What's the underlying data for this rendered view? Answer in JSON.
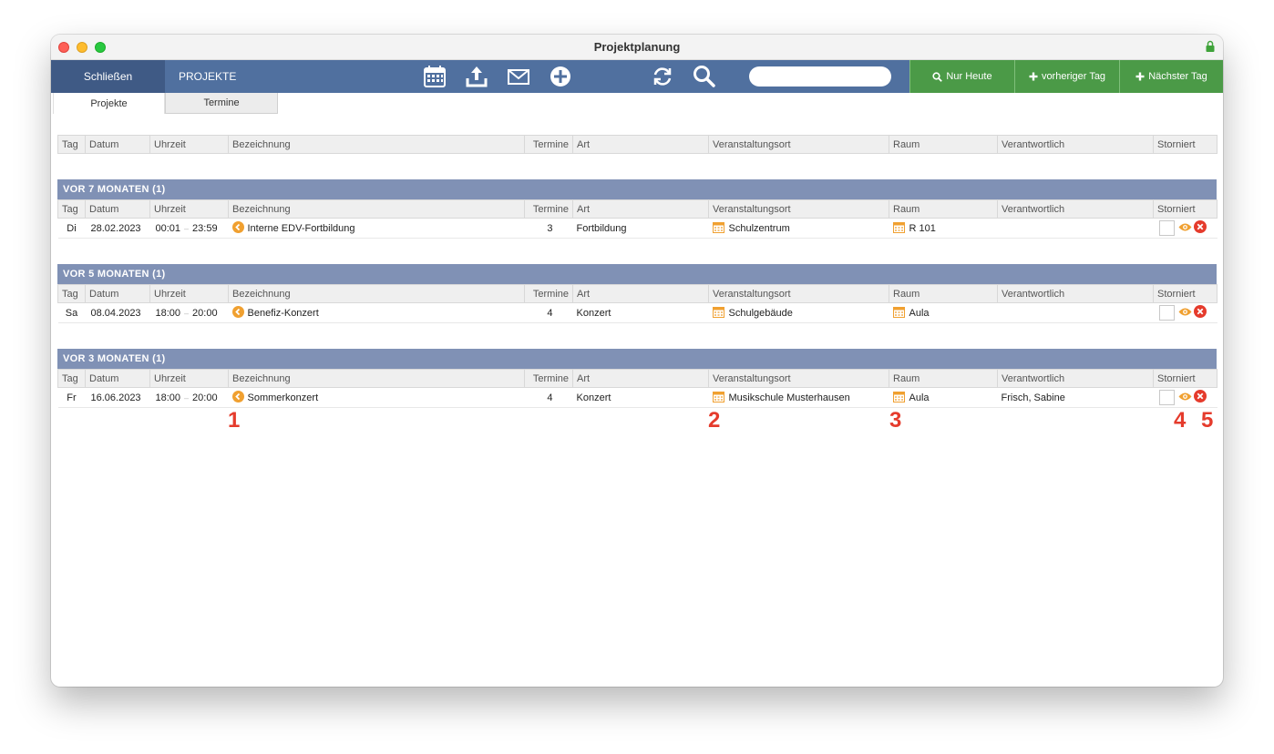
{
  "window": {
    "title": "Projektplanung"
  },
  "toolbar": {
    "close_label": "Schließen",
    "section": "PROJEKTE",
    "search_placeholder": "",
    "nur_heute": "Nur Heute",
    "prev_day": "vorheriger Tag",
    "next_day": "Nächster Tag"
  },
  "tabs": [
    "Projekte",
    "Termine"
  ],
  "columns": [
    "Tag",
    "Datum",
    "Uhrzeit",
    "Bezeichnung",
    "Termine",
    "Art",
    "Veranstaltungsort",
    "Raum",
    "Verantwortlich",
    "Storniert"
  ],
  "groups": [
    {
      "title": "VOR 7 MONATEN (1)",
      "rows": [
        {
          "tag": "Di",
          "datum": "28.02.2023",
          "von": "00:01",
          "sep": "–",
          "bis": "23:59",
          "bezeichnung": "Interne EDV-Fortbildung",
          "termine": "3",
          "art": "Fortbildung",
          "ort": "Schulzentrum",
          "raum": "R 101",
          "verantwortlich": ""
        }
      ]
    },
    {
      "title": "VOR 5 MONATEN (1)",
      "rows": [
        {
          "tag": "Sa",
          "datum": "08.04.2023",
          "von": "18:00",
          "sep": "–",
          "bis": "20:00",
          "bezeichnung": "Benefiz-Konzert",
          "termine": "4",
          "art": "Konzert",
          "ort": "Schulgebäude",
          "raum": "Aula",
          "verantwortlich": ""
        }
      ]
    },
    {
      "title": "VOR 3 MONATEN (1)",
      "rows": [
        {
          "tag": "Fr",
          "datum": "16.06.2023",
          "von": "18:00",
          "sep": "–",
          "bis": "20:00",
          "bezeichnung": "Sommerkonzert",
          "termine": "4",
          "art": "Konzert",
          "ort": "Musikschule Musterhausen",
          "raum": "Aula",
          "verantwortlich": "Frisch, Sabine"
        }
      ]
    }
  ],
  "markers": [
    "1",
    "2",
    "3",
    "4",
    "5"
  ],
  "colors": {
    "toolbar": "#50709f",
    "close_button": "#3f5a85",
    "green": "#4b9a47",
    "group_bar": "#8091b5",
    "marker": "#e53b2c",
    "accent_orange": "#f0a030"
  }
}
